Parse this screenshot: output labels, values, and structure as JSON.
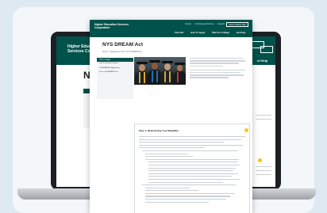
{
  "laptop_page": {
    "logo": "Higher Education Services Corporation",
    "title_partial": "NY",
    "nav_partial": "nl Help"
  },
  "document": {
    "logo": "Higher Education Services Corporation",
    "top_links": [
      "Contact",
      "For Employers/Partners",
      "Español"
    ],
    "search_label": "Search Options Help",
    "nav": [
      "Find Aid",
      "How To Apply",
      "Plan For College",
      "Get Help"
    ],
    "title": "NYS DREAM Act",
    "breadcrumb": "Home > Applying For Aid > NYS DREAM Act",
    "sidebar": {
      "heading": "How to Apply",
      "items": [
        "Find a State Aid Program",
        "NYDREAM Act Application",
        "Print a NYDREAM Form"
      ]
    },
    "box_title": "Step 1: Determining Your Eligibility"
  },
  "colors": {
    "brand_green": "#00524b",
    "accent_yellow": "#f5c518"
  }
}
